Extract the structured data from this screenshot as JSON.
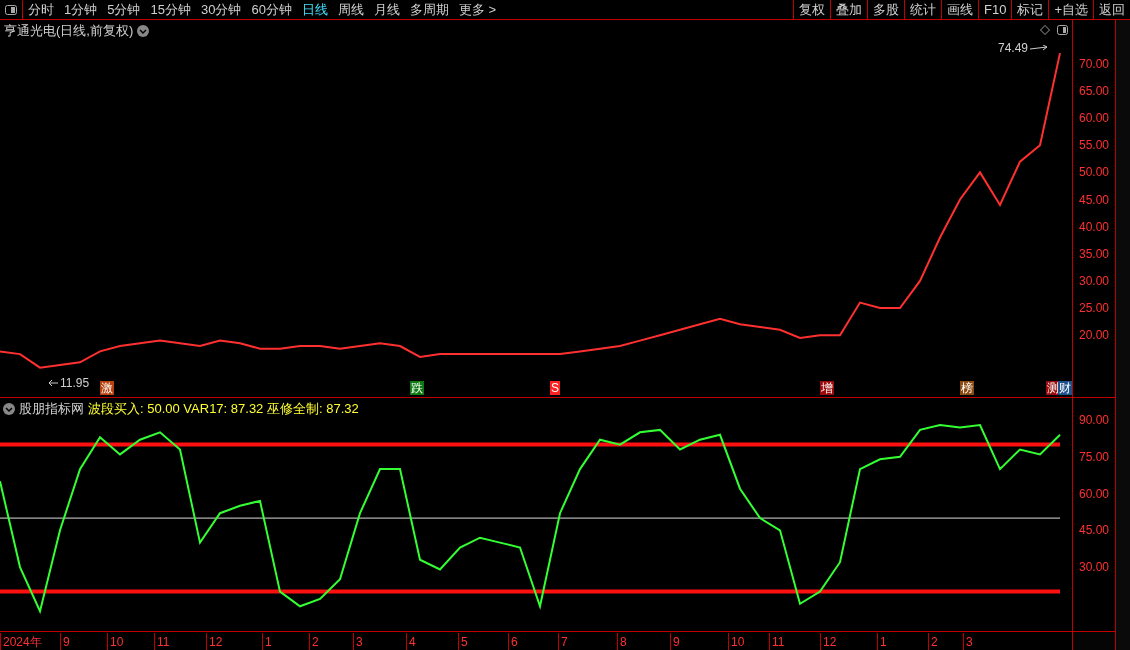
{
  "toolbar": {
    "periods": [
      {
        "label": "分时",
        "selected": false
      },
      {
        "label": "1分钟",
        "selected": false
      },
      {
        "label": "5分钟",
        "selected": false
      },
      {
        "label": "15分钟",
        "selected": false
      },
      {
        "label": "30分钟",
        "selected": false
      },
      {
        "label": "60分钟",
        "selected": false
      },
      {
        "label": "日线",
        "selected": true
      },
      {
        "label": "周线",
        "selected": false
      },
      {
        "label": "月线",
        "selected": false
      },
      {
        "label": "多周期",
        "selected": false
      },
      {
        "label": "更多 >",
        "selected": false
      }
    ],
    "buttons": [
      "复权",
      "叠加",
      "多股",
      "统计",
      "画线",
      "F10",
      "标记",
      "+自选",
      "返回"
    ]
  },
  "price_panel": {
    "title": "亨通光电(日线,前复权)",
    "high_label": "74.49",
    "low_label": "11.95",
    "markers": [
      {
        "text": "激",
        "color": "#b8410c"
      },
      {
        "text": "跌",
        "color": "#0d7a12"
      },
      {
        "text": "S",
        "color": "#ff2020"
      },
      {
        "text": "增",
        "color": "#9b0b0b"
      },
      {
        "text": "榜",
        "color": "#8a4a10"
      },
      {
        "text": "测",
        "color": "#9b0b0b"
      },
      {
        "text": "财",
        "color": "#1d4f8a"
      }
    ],
    "chart_data": {
      "type": "line",
      "series": [
        {
          "color": "#ff3030",
          "values": [
            17,
            16.5,
            14,
            14.5,
            15,
            17,
            18,
            18.5,
            19,
            18.5,
            18,
            19,
            18.5,
            17.5,
            17.5,
            18,
            18,
            17.5,
            18,
            18.5,
            18,
            16,
            16.5,
            16.5,
            16.5,
            16.5,
            16.5,
            16.5,
            16.5,
            17,
            17.5,
            18,
            19,
            20,
            21,
            22,
            23,
            22,
            21.5,
            21,
            19.5,
            20,
            20,
            26,
            25,
            25,
            30,
            38,
            45,
            50,
            44,
            52,
            55,
            72
          ]
        }
      ],
      "ylim": [
        8.6,
        78.1
      ],
      "yticks": [
        {
          "value": 20,
          "label": "20.00"
        },
        {
          "value": 25,
          "label": "25.00"
        },
        {
          "value": 30,
          "label": "30.00"
        },
        {
          "value": 35,
          "label": "35.00"
        },
        {
          "value": 40,
          "label": "40.00"
        },
        {
          "value": 45,
          "label": "45.00"
        },
        {
          "value": 50,
          "label": "50.00"
        },
        {
          "value": 55,
          "label": "55.00"
        },
        {
          "value": 60,
          "label": "60.00"
        },
        {
          "value": 65,
          "label": "65.00"
        },
        {
          "value": 70,
          "label": "70.00"
        }
      ]
    }
  },
  "indicator_panel": {
    "name": "股朋指标网",
    "readout": "波段买入: 50.00 VAR17: 87.32 巫修全制: 87.32",
    "chart_data": {
      "type": "line",
      "series": [
        {
          "color": "#ff1010",
          "values": [
            80,
            80,
            80,
            80,
            80,
            80,
            80,
            80,
            80,
            80,
            80,
            80,
            80,
            80,
            80,
            80,
            80,
            80,
            80,
            80,
            80,
            80,
            80,
            80,
            80,
            80,
            80,
            80,
            80,
            80,
            80,
            80,
            80,
            80,
            80,
            80,
            80,
            80,
            80,
            80,
            80,
            80,
            80,
            80,
            80,
            80,
            80,
            80,
            80,
            80,
            80,
            80,
            80,
            80
          ]
        },
        {
          "color": "#dddddd",
          "values": [
            50,
            50,
            50,
            50,
            50,
            50,
            50,
            50,
            50,
            50,
            50,
            50,
            50,
            50,
            50,
            50,
            50,
            50,
            50,
            50,
            50,
            50,
            50,
            50,
            50,
            50,
            50,
            50,
            50,
            50,
            50,
            50,
            50,
            50,
            50,
            50,
            50,
            50,
            50,
            50,
            50,
            50,
            50,
            50,
            50,
            50,
            50,
            50,
            50,
            50,
            50,
            50,
            50,
            50
          ]
        },
        {
          "color": "#ff1010",
          "values": [
            20,
            20,
            20,
            20,
            20,
            20,
            20,
            20,
            20,
            20,
            20,
            20,
            20,
            20,
            20,
            20,
            20,
            20,
            20,
            20,
            20,
            20,
            20,
            20,
            20,
            20,
            20,
            20,
            20,
            20,
            20,
            20,
            20,
            20,
            20,
            20,
            20,
            20,
            20,
            20,
            20,
            20,
            20,
            20,
            20,
            20,
            20,
            20,
            20,
            20,
            20,
            20,
            20,
            20
          ]
        },
        {
          "color": "#33ff33",
          "values": [
            65,
            30,
            12,
            45,
            70,
            83,
            76,
            82,
            85,
            78,
            40,
            52,
            55,
            57,
            20,
            14,
            17,
            25,
            52,
            70,
            70,
            33,
            29,
            38,
            42,
            40,
            38,
            14,
            52,
            70,
            82,
            80,
            85,
            86,
            78,
            82,
            84,
            62,
            50,
            45,
            15,
            20,
            32,
            70,
            74,
            75,
            86,
            88,
            87,
            88,
            70,
            78,
            76,
            84
          ]
        }
      ],
      "ylim": [
        3.9,
        99
      ],
      "yticks": [
        {
          "value": 30,
          "label": "30.00"
        },
        {
          "value": 45,
          "label": "45.00"
        },
        {
          "value": 60,
          "label": "60.00"
        },
        {
          "value": 75,
          "label": "75.00"
        },
        {
          "value": 90,
          "label": "90.00"
        }
      ]
    }
  },
  "time_axis": [
    "2024年",
    "9",
    "10",
    "11",
    "12",
    "1",
    "2",
    "3",
    "4",
    "5",
    "6",
    "7",
    "8",
    "9",
    "10",
    "11",
    "12",
    "1",
    "2",
    "3"
  ]
}
